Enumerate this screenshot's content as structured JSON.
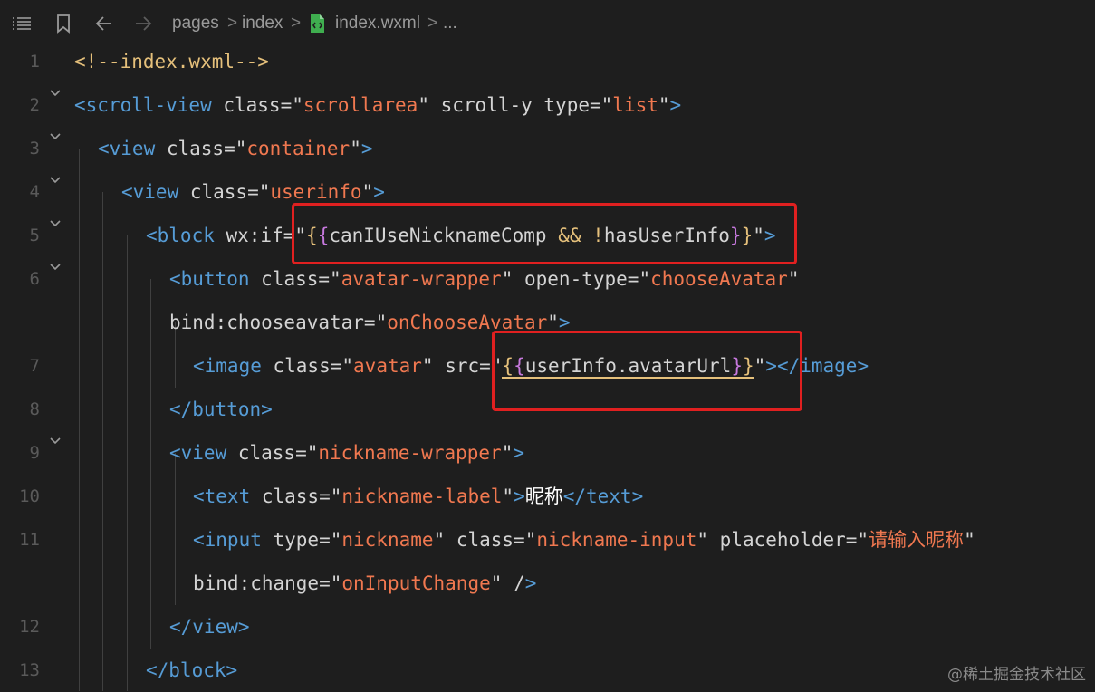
{
  "breadcrumb": {
    "items": [
      "pages",
      "index",
      "index.wxml",
      "..."
    ],
    "separator": ">"
  },
  "toolbar": {
    "icons": [
      "list-icon",
      "bookmark-icon",
      "back-arrow-icon",
      "forward-arrow-icon",
      "wxml-file-icon"
    ]
  },
  "editor": {
    "line_numbers": [
      "1",
      "2",
      "3",
      "4",
      "5",
      "6",
      "7",
      "8",
      "9",
      "10",
      "11",
      "12",
      "13"
    ],
    "lines": [
      "<!--index.wxml-->",
      "<scroll-view class=\"scrollarea\" scroll-y type=\"list\">",
      "<view class=\"container\">",
      "<view class=\"userinfo\">",
      "<block wx:if=\"{{canIUseNicknameComp && !hasUserInfo}}\">",
      "<button class=\"avatar-wrapper\" open-type=\"chooseAvatar\"",
      "bind:chooseavatar=\"onChooseAvatar\">",
      "<image class=\"avatar\" src=\"{{userInfo.avatarUrl}}\"></image>",
      "</button>",
      "<view class=\"nickname-wrapper\">",
      "<text class=\"nickname-label\">昵称</text>",
      "<input type=\"nickname\" class=\"nickname-input\" placeholder=\"请输入昵称\"",
      "bind:change=\"onInputChange\" />",
      "</view>",
      "</block>"
    ]
  },
  "watermark": "@稀土掘金技术社区",
  "colors": {
    "background": "#1e1e1e",
    "tag": "#569cd6",
    "string": "#f07850",
    "comment": "#e5c07b",
    "highlight_box": "#e02020"
  }
}
